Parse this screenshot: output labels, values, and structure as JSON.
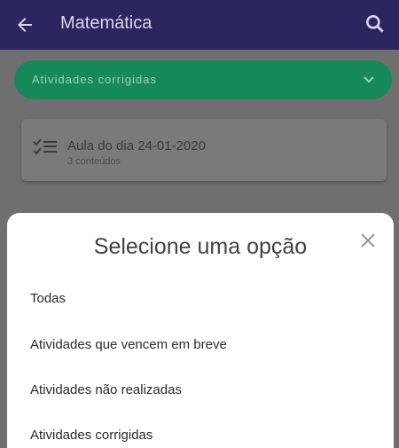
{
  "appbar": {
    "title": "Matemática",
    "back_icon": "arrow-left-icon",
    "search_icon": "search-icon",
    "color": "#2b2660"
  },
  "filter": {
    "label": "Atividades corrigidas",
    "color": "#15895a",
    "icon": "chevron-down-icon"
  },
  "card": {
    "icon": "checklist-icon",
    "title": "Aula do dia 24-01-2020",
    "subtitle": "3 conteúdos"
  },
  "sheet": {
    "heading": "Selecione uma opção",
    "close_icon": "close-icon",
    "options": [
      "Todas",
      "Atividades que vencem em breve",
      "Atividades não realizadas",
      "Atividades corrigidas"
    ]
  }
}
